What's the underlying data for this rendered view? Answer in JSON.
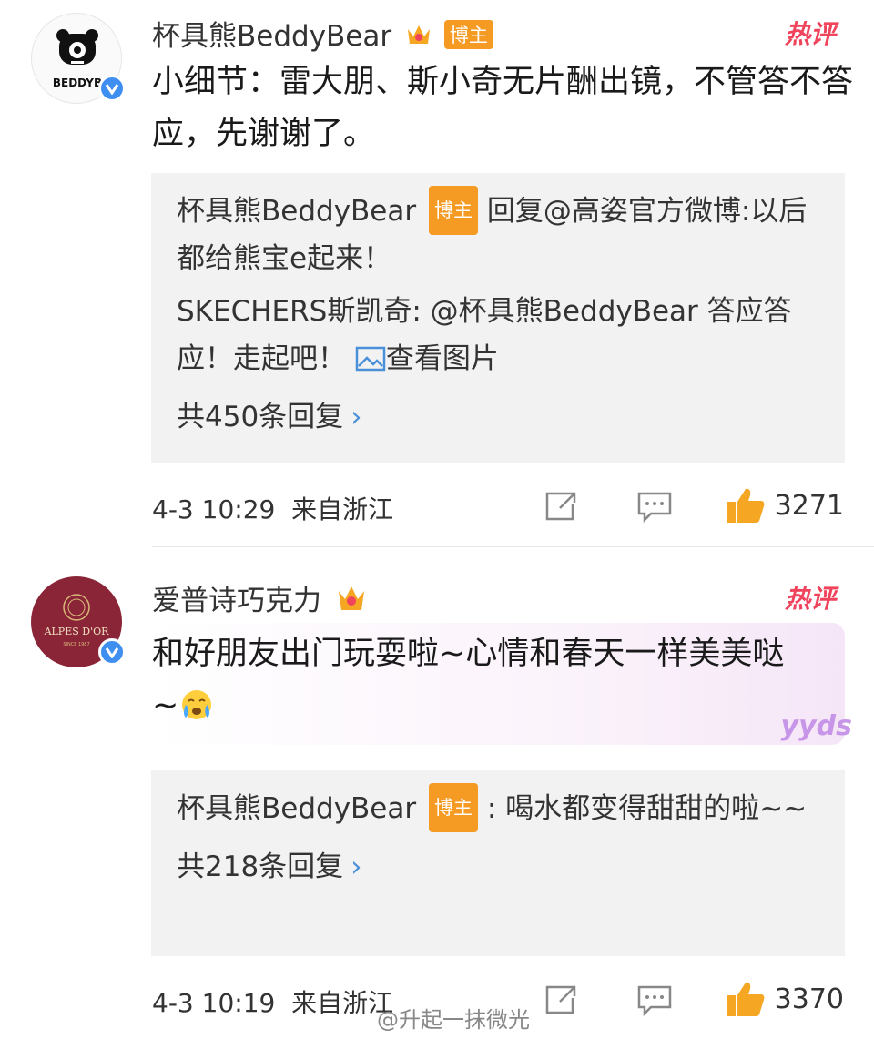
{
  "comments": [
    {
      "username": "杯具熊BeddyBear",
      "avatar_text": "BEDDYB",
      "badge": "博主",
      "hot_label": "热评",
      "text": "小细节：雷大朋、斯小奇无片酬出镜，不管答不答应，先谢谢了。",
      "replies": [
        {
          "user": "杯具熊BeddyBear",
          "tag": "博主",
          "text": " 回复@高姿官方微博:以后都给熊宝e起来！"
        },
        {
          "user": "SKECHERS斯凯奇:",
          "text": " @杯具熊BeddyBear 答应答应！走起吧！",
          "link": "查看图片"
        }
      ],
      "reply_count_label": "共450条回复",
      "time": "4-3 10:29",
      "location": "来自浙江",
      "likes": "3271"
    },
    {
      "username": "爱普诗巧克力",
      "avatar_text": "ALPES D'OR",
      "avatar_subtext": "SINCE 1987",
      "hot_label": "热评",
      "text": "和好朋友出门玩耍啦~心情和春天一样美美哒~",
      "sticker": "yyds",
      "replies": [
        {
          "user": "杯具熊BeddyBear",
          "tag": "博主",
          "text": " : 喝水都变得甜甜的啦~~"
        }
      ],
      "reply_count_label": "共218条回复",
      "time": "4-3 10:19",
      "location": "来自浙江",
      "likes": "3370"
    }
  ],
  "watermark": "@升起一抹微光",
  "colors": {
    "verified": "#3f8ff0",
    "blogger": "#f59a23",
    "hot": "#f0445d",
    "like": "#f5a623",
    "link": "#4a90d9"
  }
}
